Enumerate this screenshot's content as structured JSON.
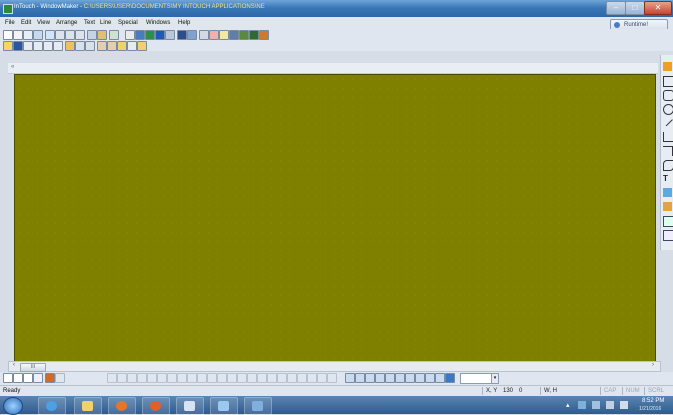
{
  "window": {
    "title_prefix": "InTouch - WindowMaker - ",
    "title_path": "C:\\USERS\\USER\\DOCUMENTS\\MY INTOUCH APPLICATIONS\\NE",
    "min_glyph": "–",
    "max_glyph": "□",
    "close_glyph": "✕"
  },
  "menu": [
    "File",
    "Edit",
    "View",
    "Arrange",
    "Text",
    "Line",
    "Special",
    "Windows",
    "Help"
  ],
  "help": {
    "label": "Runtime!"
  },
  "ruler": {
    "mark": "«"
  },
  "scrollbar": {
    "left": "‹",
    "thumb": "III",
    "right": "›"
  },
  "statusbar": {
    "status": "Ready",
    "xy_label": "X, Y",
    "x": "130",
    "y": "0",
    "wh_label": "W, H",
    "caps": "CAP",
    "num": "NUM",
    "scrl": "SCRL"
  },
  "zoom": {
    "value": "",
    "dd": "▾"
  },
  "taskbar": {
    "time": "8:52 PM",
    "date": "1/21/2016"
  },
  "colors": {
    "canvas": "#808000",
    "titlebar": "#3a78b8",
    "taskbar": "#2f5a8a"
  }
}
